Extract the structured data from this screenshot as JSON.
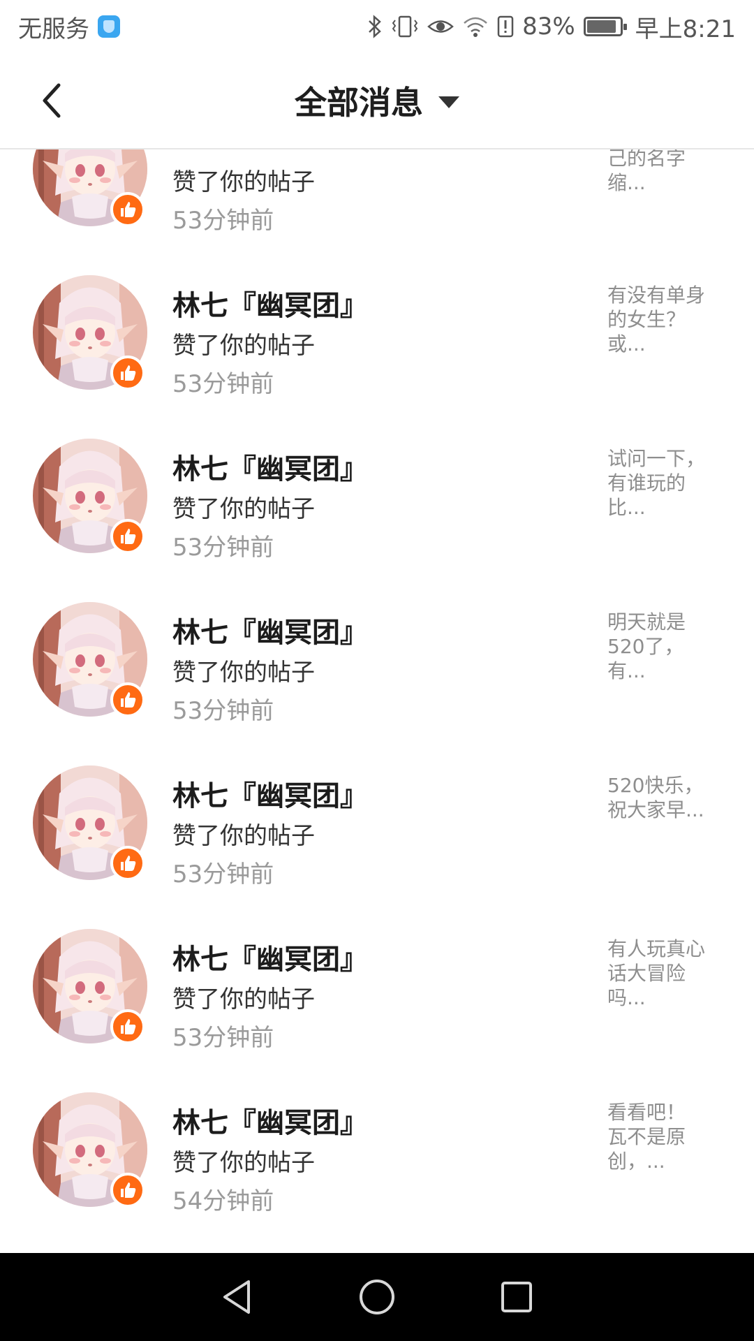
{
  "status_bar": {
    "carrier": "无服务",
    "battery_percent_label": "83%",
    "battery_level": 0.83,
    "time": "早上8:21",
    "icons": [
      "shield-icon",
      "bluetooth-icon",
      "vibrate-icon",
      "eye-icon",
      "wifi-icon",
      "alert-icon",
      "battery-icon"
    ]
  },
  "header": {
    "title": "全部消息",
    "back_icon": "chevron-left-icon",
    "filter_icon": "caret-down-icon"
  },
  "colors": {
    "badge": "#ff6a13",
    "time_text": "#9a9a9a",
    "preview_text": "#8e8e8e"
  },
  "messages": [
    {
      "name": "",
      "action": "赞了你的帖子",
      "time": "53分钟前",
      "preview": [
        "己的名字",
        "缩..."
      ]
    },
    {
      "name": "林七『幽冥团』",
      "action": "赞了你的帖子",
      "time": "53分钟前",
      "preview": [
        "有没有单身",
        "的女生？",
        "或..."
      ]
    },
    {
      "name": "林七『幽冥团』",
      "action": "赞了你的帖子",
      "time": "53分钟前",
      "preview": [
        "试问一下，",
        "有谁玩的",
        "比..."
      ]
    },
    {
      "name": "林七『幽冥团』",
      "action": "赞了你的帖子",
      "time": "53分钟前",
      "preview": [
        "明天就是",
        "520了，",
        "有..."
      ]
    },
    {
      "name": "林七『幽冥团』",
      "action": "赞了你的帖子",
      "time": "53分钟前",
      "preview": [
        "520快乐，",
        "祝大家早..."
      ]
    },
    {
      "name": "林七『幽冥团』",
      "action": "赞了你的帖子",
      "time": "53分钟前",
      "preview": [
        "有人玩真心",
        "话大冒险",
        "吗..."
      ]
    },
    {
      "name": "林七『幽冥团』",
      "action": "赞了你的帖子",
      "time": "54分钟前",
      "preview": [
        "看看吧！",
        "瓦不是原",
        "创，..."
      ]
    }
  ],
  "nav": {
    "icons": [
      "back-triangle-icon",
      "home-circle-icon",
      "recents-square-icon"
    ]
  }
}
